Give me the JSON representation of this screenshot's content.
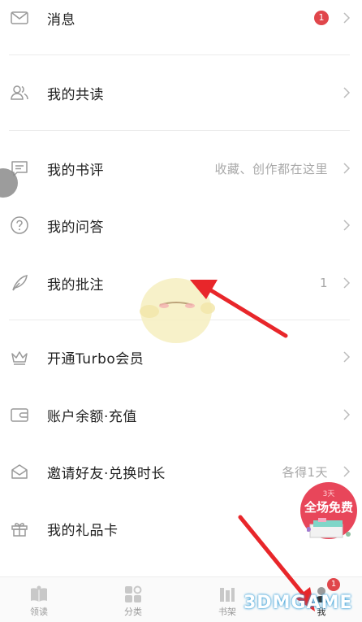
{
  "menu": {
    "items": [
      {
        "label": "消息",
        "badge": "1",
        "hint": ""
      },
      {
        "label": "我的共读",
        "hint": ""
      },
      {
        "label": "我的书评",
        "hint": "收藏、创作都在这里"
      },
      {
        "label": "我的问答",
        "hint": ""
      },
      {
        "label": "我的批注",
        "hint": "1"
      },
      {
        "label": "开通Turbo会员",
        "hint": ""
      },
      {
        "label": "账户余额·充值",
        "hint": ""
      },
      {
        "label": "邀请好友·兑换时长",
        "hint": "各得1天"
      },
      {
        "label": "我的礼品卡",
        "hint": ""
      }
    ]
  },
  "promo": {
    "small": "3天",
    "big": "全场免费"
  },
  "tabbar": {
    "tabs": [
      {
        "label": "领读"
      },
      {
        "label": "分类"
      },
      {
        "label": "书架"
      },
      {
        "label": "我"
      }
    ],
    "me_badge": "1"
  },
  "watermark": "3DMGAME",
  "colors": {
    "badge": "#e0464b",
    "arrow": "#e8262a",
    "divider": "#ececec",
    "hint": "#a8a8a8",
    "promo": "#e8465a"
  }
}
